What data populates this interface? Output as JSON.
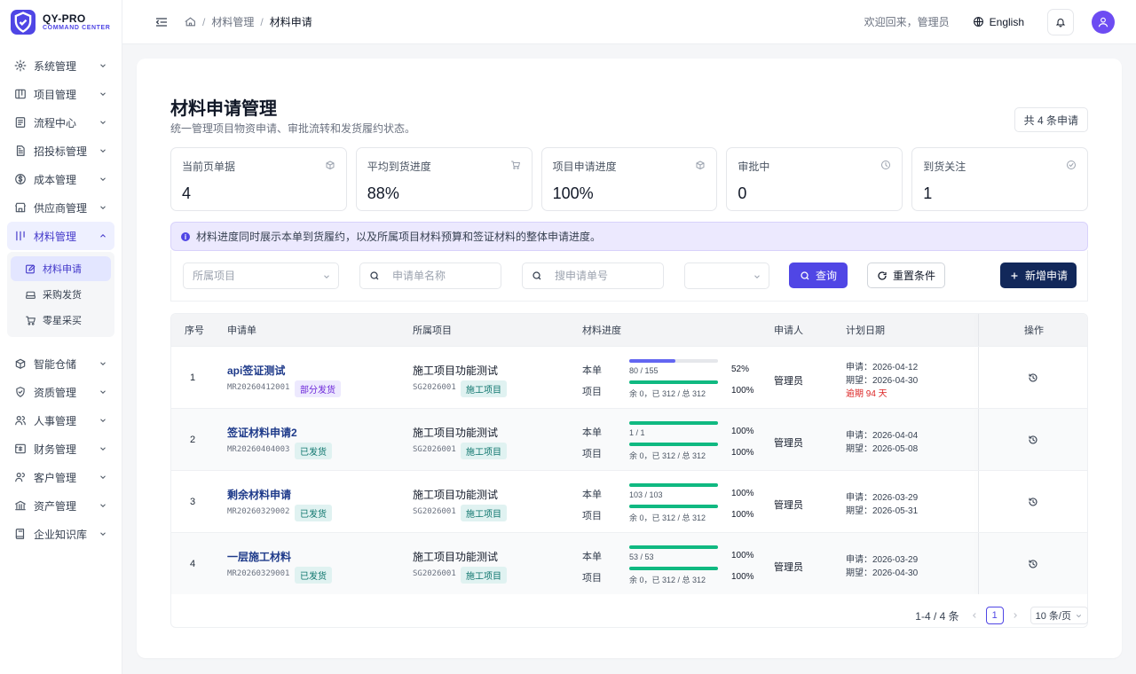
{
  "brand": {
    "title": "QY-PRO",
    "subtitle": "COMMAND CENTER",
    "accent": "#4f46e5"
  },
  "sidebar": {
    "groups_top": [
      {
        "label": "系统管理",
        "icon": "gear-icon"
      },
      {
        "label": "项目管理",
        "icon": "board-icon"
      },
      {
        "label": "流程中心",
        "icon": "flow-icon"
      },
      {
        "label": "招投标管理",
        "icon": "doc-icon"
      },
      {
        "label": "成本管理",
        "icon": "dollar-icon"
      },
      {
        "label": "供应商管理",
        "icon": "store-icon"
      }
    ],
    "active_group": {
      "label": "材料管理",
      "icon": "bars-icon"
    },
    "sub_items": [
      {
        "label": "材料申请",
        "icon": "edit-icon"
      },
      {
        "label": "采购发货",
        "icon": "truck-icon"
      },
      {
        "label": "零星采买",
        "icon": "cart-icon"
      }
    ],
    "groups_bottom": [
      {
        "label": "智能仓储",
        "icon": "box-icon"
      },
      {
        "label": "资质管理",
        "icon": "shield-icon"
      },
      {
        "label": "人事管理",
        "icon": "users-icon"
      },
      {
        "label": "财务管理",
        "icon": "finance-icon"
      },
      {
        "label": "客户管理",
        "icon": "client-icon"
      },
      {
        "label": "资产管理",
        "icon": "bank-icon"
      },
      {
        "label": "企业知识库",
        "icon": "book-icon"
      }
    ]
  },
  "header": {
    "breadcrumb": [
      "材料管理",
      "材料申请"
    ],
    "welcome": "欢迎回来，管理员",
    "language": "English"
  },
  "page": {
    "title": "材料申请管理",
    "description": "统一管理项目物资申请、审批流转和发货履约状态。",
    "total_label": "共 4 条申请"
  },
  "stats": [
    {
      "label": "当前页单据",
      "value": "4",
      "icon": "box-icon"
    },
    {
      "label": "平均到货进度",
      "value": "88%",
      "icon": "cart-icon"
    },
    {
      "label": "项目申请进度",
      "value": "100%",
      "icon": "box-icon"
    },
    {
      "label": "审批中",
      "value": "0",
      "icon": "clock-icon"
    },
    {
      "label": "到货关注",
      "value": "1",
      "icon": "check-circle-icon"
    }
  ],
  "notice": "材料进度同时展示本单到货履约，以及所属项目材料预算和签证材料的整体申请进度。",
  "filters": {
    "project_placeholder": "所属项目",
    "name_placeholder": "申请单名称",
    "code_placeholder": "搜申请单号",
    "status_value": "",
    "query_label": "查询",
    "reset_label": "重置条件",
    "add_label": "新增申请"
  },
  "table": {
    "headers": [
      "序号",
      "申请单",
      "所属项目",
      "材料进度",
      "申请人",
      "计划日期",
      "操作"
    ],
    "row_labels": {
      "own": "本单",
      "project": "项目"
    },
    "rows": [
      {
        "index": "1",
        "name": "api签证测试",
        "code": "MR20260412001",
        "status": "部分发货",
        "status_kind": "partial",
        "project": "施工项目功能测试",
        "project_code": "SG2026001",
        "project_tag": "施工项目",
        "own_text": "80 / 155",
        "own_pct": "52%",
        "own_frac": 0.52,
        "proj_text": "余 0，已 312 / 总 312",
        "proj_pct": "100%",
        "proj_frac": 1.0,
        "applicant": "管理员",
        "apply_date": "申请：2026-04-12",
        "expect_date": "期望：2026-04-30",
        "overdue": "逾期 94 天"
      },
      {
        "index": "2",
        "name": "签证材料申请2",
        "code": "MR20260404003",
        "status": "已发货",
        "status_kind": "done",
        "project": "施工项目功能测试",
        "project_code": "SG2026001",
        "project_tag": "施工项目",
        "own_text": "1 / 1",
        "own_pct": "100%",
        "own_frac": 1.0,
        "proj_text": "余 0，已 312 / 总 312",
        "proj_pct": "100%",
        "proj_frac": 1.0,
        "applicant": "管理员",
        "apply_date": "申请：2026-04-04",
        "expect_date": "期望：2026-05-08",
        "overdue": ""
      },
      {
        "index": "3",
        "name": "剩余材料申请",
        "code": "MR20260329002",
        "status": "已发货",
        "status_kind": "done",
        "project": "施工项目功能测试",
        "project_code": "SG2026001",
        "project_tag": "施工项目",
        "own_text": "103 / 103",
        "own_pct": "100%",
        "own_frac": 1.0,
        "proj_text": "余 0，已 312 / 总 312",
        "proj_pct": "100%",
        "proj_frac": 1.0,
        "applicant": "管理员",
        "apply_date": "申请：2026-03-29",
        "expect_date": "期望：2026-05-31",
        "overdue": ""
      },
      {
        "index": "4",
        "name": "一层施工材料",
        "code": "MR20260329001",
        "status": "已发货",
        "status_kind": "done",
        "project": "施工项目功能测试",
        "project_code": "SG2026001",
        "project_tag": "施工项目",
        "own_text": "53 / 53",
        "own_pct": "100%",
        "own_frac": 1.0,
        "proj_text": "余 0，已 312 / 总 312",
        "proj_pct": "100%",
        "proj_frac": 1.0,
        "applicant": "管理员",
        "apply_date": "申请：2026-03-29",
        "expect_date": "期望：2026-04-30",
        "overdue": ""
      }
    ]
  },
  "pagination": {
    "range": "1-4 / 4 条",
    "current": "1",
    "page_size": "10 条/页"
  },
  "colors": {
    "primary": "#5046e5",
    "dark": "#12285a",
    "progress_partial": "#6366f1",
    "progress_full": "#10b981"
  }
}
